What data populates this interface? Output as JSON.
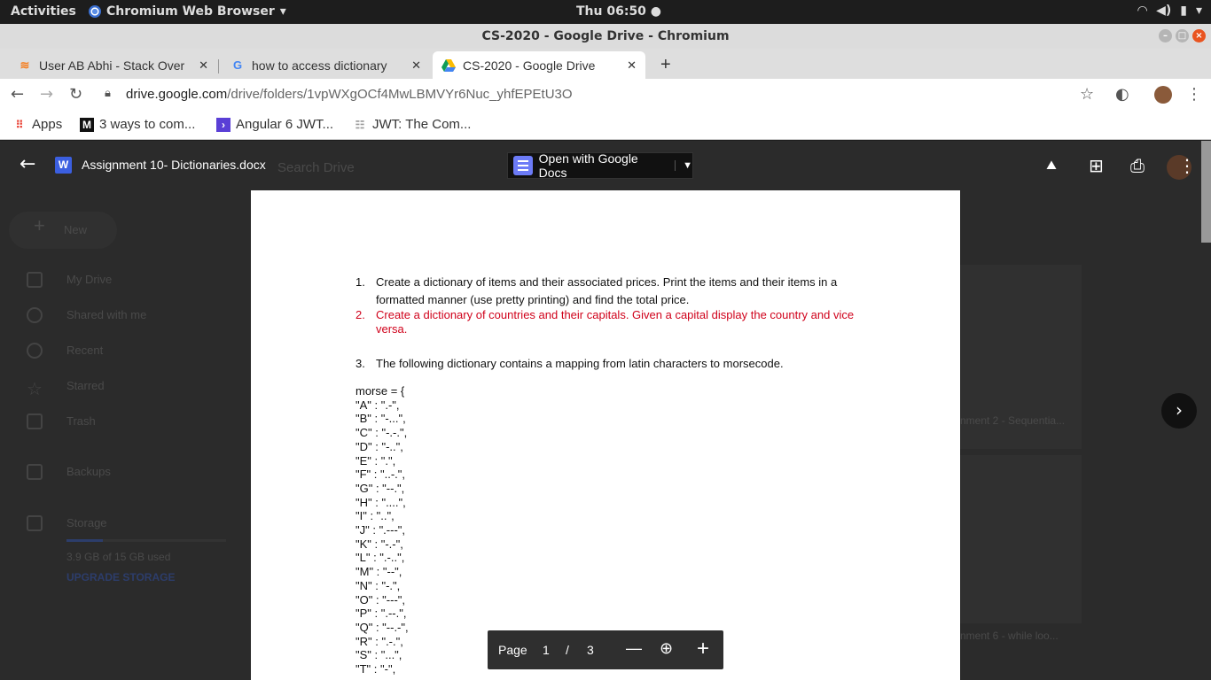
{
  "system_bar": {
    "activities": "Activities",
    "app_name": "Chromium Web Browser",
    "clock": "Thu 06:50"
  },
  "window": {
    "title": "CS-2020 - Google Drive - Chromium"
  },
  "tabs": [
    {
      "label": "User AB Abhi - Stack Over",
      "icon": "stackoverflow-icon"
    },
    {
      "label": "how to access dictionary",
      "icon": "google-icon"
    },
    {
      "label": "CS-2020 - Google Drive",
      "icon": "google-drive-icon",
      "active": true
    }
  ],
  "omnibox": {
    "domain": "drive.google.com",
    "path": "/drive/folders/1vpWXgOCf4MwLBMVYr6Nuc_yhfEPEtU3O"
  },
  "bookmarks": [
    {
      "label": "Apps",
      "icon": "apps-grid-icon"
    },
    {
      "label": "3 ways to com...",
      "icon": "medium-icon"
    },
    {
      "label": "Angular 6 JWT...",
      "icon": "angular-icon"
    },
    {
      "label": "JWT: The Com...",
      "icon": "doc-icon"
    }
  ],
  "drive_bg": {
    "search_placeholder": "Search Drive",
    "new_label": "New",
    "nav": [
      "My Drive",
      "Shared with me",
      "Recent",
      "Starred",
      "Trash",
      "Backups",
      "Storage"
    ],
    "storage_used": "3.9 GB of 15 GB used",
    "upgrade": "UPGRADE STORAGE",
    "file1": "nment 2 - Sequentia...",
    "file2": "nment 6 - while loo..."
  },
  "preview": {
    "file_name": "Assignment 10- Dictionaries.docx",
    "file_badge": "W",
    "open_with": "Open with Google Docs"
  },
  "document": {
    "item1_num": "1.",
    "item1_line1": "Create a dictionary of items and their associated prices. Print the items and their items in a",
    "item1_line2": "formatted manner (use pretty printing) and find the total price.",
    "item2_num": "2.",
    "item2_line1": "Create a dictionary of countries and their capitals. Given a capital display the country and vice",
    "item2_line2": "versa.",
    "item3_num": "3.",
    "item3_text": "The following dictionary contains a mapping from latin characters to morsecode.",
    "morse_lines": [
      "morse = {",
      "\"A\" : \".-\",",
      "\"B\" : \"-...\",",
      "\"C\" : \"-.-.\",",
      "\"D\" : \"-..\",",
      "\"E\" : \".\",",
      "\"F\" : \"..-.\",",
      "\"G\" : \"--.\",",
      "\"H\" : \"....\",",
      "\"I\" : \"..\",",
      "\"J\" : \".---\",",
      "\"K\" : \"-.-\",",
      "\"L\" : \".-..\",",
      "\"M\" : \"--\",",
      "\"N\" : \"-.\",",
      "\"O\" : \"---\",",
      "\"P\" : \".--.\",",
      "\"Q\" : \"--.-\",",
      "\"R\" : \".-.\",",
      "\"S\" : \"...\",",
      "\"T\" : \"-\","
    ]
  },
  "pager": {
    "label": "Page",
    "current": "1",
    "slash": "/",
    "total": "3"
  }
}
